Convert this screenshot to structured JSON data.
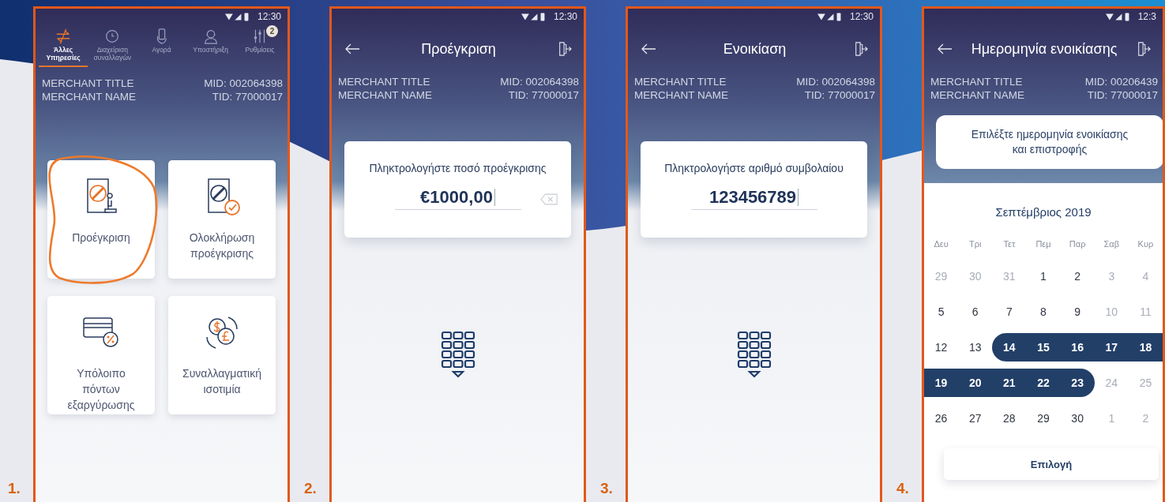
{
  "steps": [
    {
      "number": "1.",
      "kind": "menu",
      "status_time": "12:30",
      "merchant": {
        "title": "MERCHANT TITLE",
        "name": "MERCHANT NAME",
        "mid": "MID: 002064398",
        "tid": "TID: 77000017"
      },
      "tabs": [
        {
          "label": "Άλλες Υπηρεσίες",
          "selected": true
        },
        {
          "label": "Διαχείριση συναλλαγών",
          "selected": false
        },
        {
          "label": "Αγορά",
          "selected": false
        },
        {
          "label": "Υποστήριξη",
          "selected": false
        },
        {
          "label": "Ρυθμίσεις",
          "selected": false,
          "badge": "2"
        }
      ],
      "tiles": [
        {
          "label": "Προέγκριση",
          "highlighted": true
        },
        {
          "label": "Ολοκλήρωση προέγκρισης",
          "highlighted": false
        },
        {
          "label": "Υπόλοιπο πόντων εξαργύρωσης",
          "highlighted": false
        },
        {
          "label": "Συναλλαγματική ισοτιμία",
          "highlighted": false
        }
      ]
    },
    {
      "number": "2.",
      "kind": "entry",
      "status_time": "12:30",
      "title": "Προέγκριση",
      "merchant": {
        "title": "MERCHANT TITLE",
        "name": "MERCHANT NAME",
        "mid": "MID: 002064398",
        "tid": "TID: 77000017"
      },
      "prompt": "Πληκτρολογήστε ποσό προέγκρισης",
      "value": "€1000,00",
      "clear_button": true
    },
    {
      "number": "3.",
      "kind": "entry",
      "status_time": "12:30",
      "title": "Ενοικίαση",
      "merchant": {
        "title": "MERCHANT TITLE",
        "name": "MERCHANT NAME",
        "mid": "MID: 002064398",
        "tid": "TID: 77000017"
      },
      "prompt": "Πληκτρολογήστε αριθμό συμβολαίου",
      "value": "123456789",
      "clear_button": false
    },
    {
      "number": "4.",
      "kind": "calendar",
      "status_time": "12:3",
      "title": "Ημερομηνία ενοικίασης",
      "merchant": {
        "title": "MERCHANT TITLE",
        "name": "MERCHANT NAME",
        "mid": "MID: 00206439",
        "tid": "TID: 77000017"
      },
      "instruction": "Επιλέξτε ημερομηνία ενοικίασης και επιστροφής",
      "month": "Σεπτέμβριος 2019",
      "weekdays": [
        "Δευ",
        "Τρι",
        "Τετ",
        "Πεμ",
        "Παρ",
        "Σαβ",
        "Κυρ"
      ],
      "days": [
        {
          "label": "29",
          "disabled": true,
          "selected": false
        },
        {
          "label": "30",
          "disabled": true,
          "selected": false
        },
        {
          "label": "31",
          "disabled": true,
          "selected": false
        },
        {
          "label": "1",
          "disabled": false,
          "selected": false
        },
        {
          "label": "2",
          "disabled": false,
          "selected": false
        },
        {
          "label": "3",
          "disabled": true,
          "selected": false
        },
        {
          "label": "4",
          "disabled": true,
          "selected": false
        },
        {
          "label": "5",
          "disabled": false,
          "selected": false
        },
        {
          "label": "6",
          "disabled": false,
          "selected": false
        },
        {
          "label": "7",
          "disabled": false,
          "selected": false
        },
        {
          "label": "8",
          "disabled": false,
          "selected": false
        },
        {
          "label": "9",
          "disabled": false,
          "selected": false
        },
        {
          "label": "10",
          "disabled": true,
          "selected": false
        },
        {
          "label": "11",
          "disabled": true,
          "selected": false
        },
        {
          "label": "12",
          "disabled": false,
          "selected": false
        },
        {
          "label": "13",
          "disabled": false,
          "selected": false
        },
        {
          "label": "14",
          "disabled": false,
          "selected": true
        },
        {
          "label": "15",
          "disabled": false,
          "selected": true
        },
        {
          "label": "16",
          "disabled": false,
          "selected": true
        },
        {
          "label": "17",
          "disabled": false,
          "selected": true
        },
        {
          "label": "18",
          "disabled": false,
          "selected": true
        },
        {
          "label": "19",
          "disabled": false,
          "selected": true
        },
        {
          "label": "20",
          "disabled": false,
          "selected": true
        },
        {
          "label": "21",
          "disabled": false,
          "selected": true
        },
        {
          "label": "22",
          "disabled": false,
          "selected": true
        },
        {
          "label": "23",
          "disabled": false,
          "selected": true
        },
        {
          "label": "24",
          "disabled": true,
          "selected": false
        },
        {
          "label": "25",
          "disabled": true,
          "selected": false
        },
        {
          "label": "26",
          "disabled": false,
          "selected": false
        },
        {
          "label": "27",
          "disabled": false,
          "selected": false
        },
        {
          "label": "28",
          "disabled": false,
          "selected": false
        },
        {
          "label": "29",
          "disabled": false,
          "selected": false
        },
        {
          "label": "30",
          "disabled": false,
          "selected": false
        },
        {
          "label": "1",
          "disabled": true,
          "selected": false
        },
        {
          "label": "2",
          "disabled": true,
          "selected": false
        }
      ],
      "button": "Επιλογή"
    }
  ]
}
